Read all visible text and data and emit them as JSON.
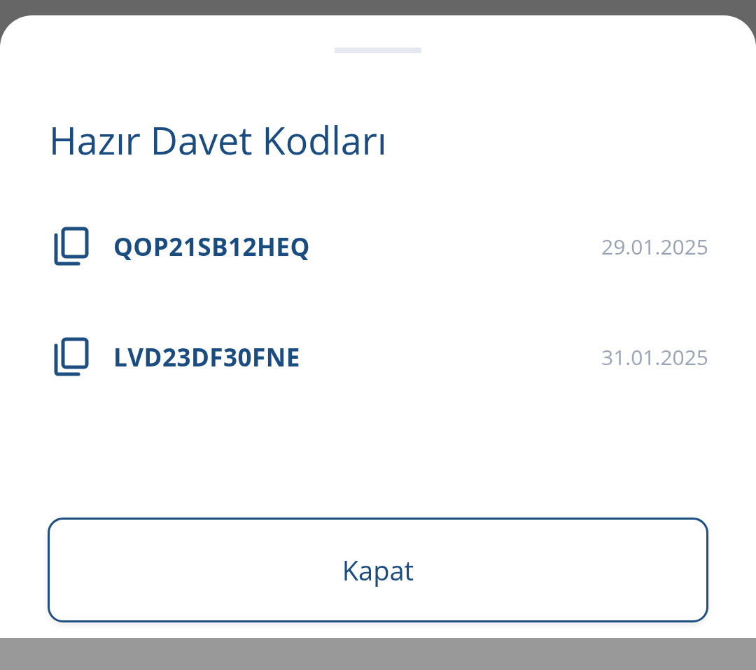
{
  "sheet": {
    "title": "Hazır Davet Kodları"
  },
  "codes": [
    {
      "code": "QOP21SB12HEQ",
      "date": "29.01.2025"
    },
    {
      "code": "LVD23DF30FNE",
      "date": "31.01.2025"
    }
  ],
  "buttons": [
    {
      "label": "Kapat",
      "kind": "outline"
    }
  ]
}
